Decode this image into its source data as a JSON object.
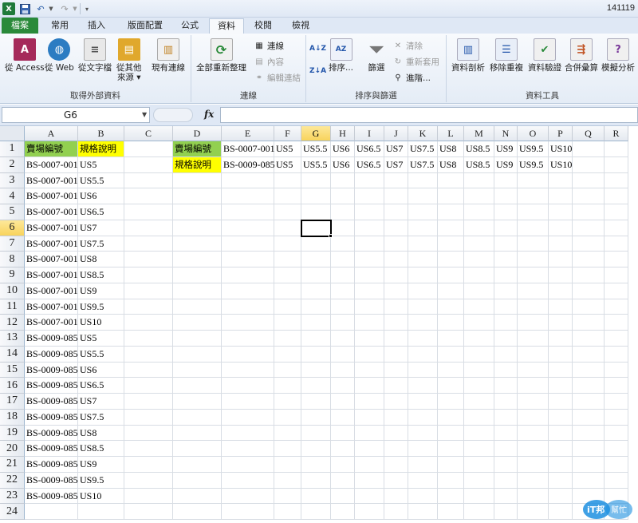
{
  "titlebar": {
    "app_icon": "X",
    "doc_title": "141119"
  },
  "tabs": [
    "檔案",
    "常用",
    "插入",
    "版面配置",
    "公式",
    "資料",
    "校閱",
    "檢視"
  ],
  "active_tab": "資料",
  "ribbon": {
    "groups": {
      "external": "取得外部資料",
      "connections": "連線",
      "sortfilter": "排序與篩選",
      "datatools": "資料工具"
    },
    "external": [
      "從 Access",
      "從 Web",
      "從文字檔",
      "從其他",
      "來源 ▾",
      "現有連線"
    ],
    "refresh_all": "全部重新整理",
    "connections_small": [
      "連線",
      "內容",
      "編輯連結"
    ],
    "sort_icons": [
      "A↓Z",
      "Z↓A"
    ],
    "sort": "排序...",
    "filter": "篩選",
    "filter_small": [
      "清除",
      "重新套用",
      "進階..."
    ],
    "datatools": [
      "資料剖析",
      "移除重複",
      "資料驗證",
      "合併彙算",
      "模擬分析"
    ]
  },
  "formula_bar": {
    "name_box": "G6",
    "fx": "fx",
    "formula": ""
  },
  "columns": [
    "A",
    "B",
    "C",
    "D",
    "E",
    "F",
    "G",
    "H",
    "I",
    "J",
    "K",
    "L",
    "M",
    "N",
    "O",
    "P",
    "Q",
    "R"
  ],
  "rows": [
    "1",
    "2",
    "3",
    "4",
    "5",
    "6",
    "7",
    "8",
    "9",
    "10",
    "11",
    "12",
    "13",
    "14",
    "15",
    "16",
    "17",
    "18",
    "19",
    "20",
    "21",
    "22",
    "23",
    "24"
  ],
  "selected_cell": {
    "col": "G",
    "row": "6"
  },
  "colA": [
    "賣場編號",
    "BS-0007-001",
    "BS-0007-001",
    "BS-0007-001",
    "BS-0007-001",
    "BS-0007-001",
    "BS-0007-001",
    "BS-0007-001",
    "BS-0007-001",
    "BS-0007-001",
    "BS-0007-001",
    "BS-0007-001",
    "BS-0009-085",
    "BS-0009-085",
    "BS-0009-085",
    "BS-0009-085",
    "BS-0009-085",
    "BS-0009-085",
    "BS-0009-085",
    "BS-0009-085",
    "BS-0009-085",
    "BS-0009-085",
    "BS-0009-085"
  ],
  "colB": [
    "規格說明",
    "US5",
    "US5.5",
    "US6",
    "US6.5",
    "US7",
    "US7.5",
    "US8",
    "US8.5",
    "US9",
    "US9.5",
    "US10",
    "US5",
    "US5.5",
    "US6",
    "US6.5",
    "US7",
    "US7.5",
    "US8",
    "US8.5",
    "US9",
    "US9.5",
    "US10"
  ],
  "row1_right": [
    "賣場編號",
    "BS-0007-001",
    "US5",
    "US5.5",
    "US6",
    "US6.5",
    "US7",
    "US7.5",
    "US8",
    "US8.5",
    "US9",
    "US9.5",
    "US10"
  ],
  "row2_right": [
    "規格說明",
    "BS-0009-085",
    "US5",
    "US5.5",
    "US6",
    "US6.5",
    "US7",
    "US7.5",
    "US8",
    "US8.5",
    "US9",
    "US9.5",
    "US10"
  ],
  "colors": {
    "green_fill": "#92d050",
    "yellow_fill": "#ffff00",
    "file_tab": "#2a8a3a",
    "selected_header": "#f8d35c"
  },
  "watermark": {
    "line1": "iT邦",
    "line2": "幫忙"
  }
}
